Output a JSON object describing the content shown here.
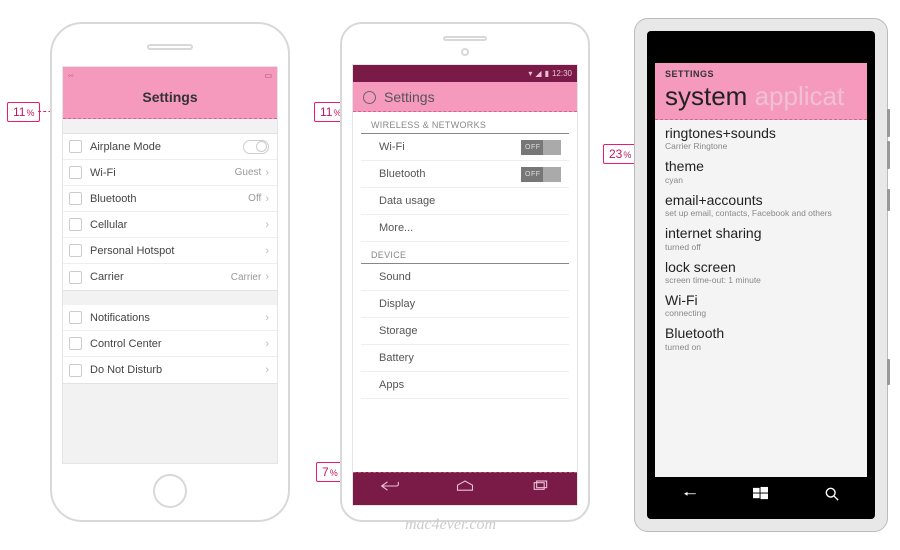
{
  "annotations": {
    "ios_header": "11",
    "and_header": "11",
    "and_nav": "7",
    "wp_header": "23",
    "pct": "%"
  },
  "watermark": "mac4ever.com",
  "ios": {
    "title": "Settings",
    "status_time": "",
    "groups": [
      [
        {
          "label": "Airplane Mode",
          "value": "",
          "switch": true,
          "chevron": false
        },
        {
          "label": "Wi-Fi",
          "value": "Guest",
          "chevron": true
        },
        {
          "label": "Bluetooth",
          "value": "Off",
          "chevron": true
        },
        {
          "label": "Cellular",
          "value": "",
          "chevron": true
        },
        {
          "label": "Personal Hotspot",
          "value": "",
          "chevron": true
        },
        {
          "label": "Carrier",
          "value": "Carrier",
          "chevron": true
        }
      ],
      [
        {
          "label": "Notifications",
          "value": "",
          "chevron": true
        },
        {
          "label": "Control Center",
          "value": "",
          "chevron": true
        },
        {
          "label": "Do Not Disturb",
          "value": "",
          "chevron": true
        }
      ]
    ]
  },
  "android": {
    "status_time": "12:30",
    "title": "Settings",
    "sections": [
      {
        "header": "WIRELESS & NETWORKS",
        "rows": [
          {
            "label": "Wi-Fi",
            "toggle": "OFF"
          },
          {
            "label": "Bluetooth",
            "toggle": "OFF"
          },
          {
            "label": "Data usage"
          },
          {
            "label": "More..."
          }
        ]
      },
      {
        "header": "DEVICE",
        "rows": [
          {
            "label": "Sound"
          },
          {
            "label": "Display"
          },
          {
            "label": "Storage"
          },
          {
            "label": "Battery"
          },
          {
            "label": "Apps"
          }
        ]
      }
    ]
  },
  "wp": {
    "header_title": "SETTINGS",
    "pivot_active": "system",
    "pivot_inactive": " applicat",
    "items": [
      {
        "t": "ringtones+sounds",
        "s": "Carrier Ringtone"
      },
      {
        "t": "theme",
        "s": "cyan"
      },
      {
        "t": "email+accounts",
        "s": "set up email, contacts, Facebook and others"
      },
      {
        "t": "internet sharing",
        "s": "turned off"
      },
      {
        "t": "lock screen",
        "s": "screen time-out: 1 minute"
      },
      {
        "t": "Wi-Fi",
        "s": "connecting"
      },
      {
        "t": "Bluetooth",
        "s": "turned on"
      }
    ]
  }
}
